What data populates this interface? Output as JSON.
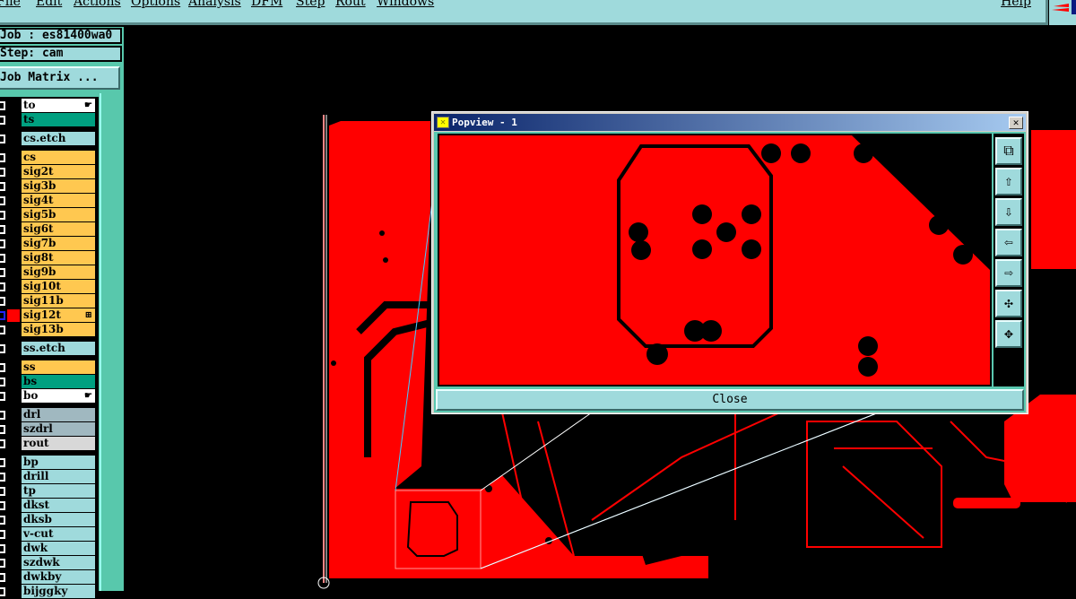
{
  "menu": [
    "File",
    "Edit",
    "Actions",
    "Options",
    "Analysis",
    "DFM",
    "Step",
    "Rout",
    "Windows"
  ],
  "menu_help": "Help",
  "job": "Job : es81400wa0",
  "step": "Step: cam",
  "job_matrix": "Job Matrix ...",
  "layers": [
    {
      "name": "to",
      "bg": "#ffffff",
      "hand": true
    },
    {
      "name": "ts",
      "bg": "#00a080"
    },
    {
      "name": "cs.etch",
      "bg": "#9fdadc"
    },
    {
      "name": "cs",
      "bg": "#ffc850"
    },
    {
      "name": "sig2t",
      "bg": "#ffc850"
    },
    {
      "name": "sig3b",
      "bg": "#ffc850"
    },
    {
      "name": "sig4t",
      "bg": "#ffc850"
    },
    {
      "name": "sig5b",
      "bg": "#ffc850"
    },
    {
      "name": "sig6t",
      "bg": "#ffc850"
    },
    {
      "name": "sig7b",
      "bg": "#ffc850"
    },
    {
      "name": "sig8t",
      "bg": "#ffc850"
    },
    {
      "name": "sig9b",
      "bg": "#ffc850"
    },
    {
      "name": "sig10t",
      "bg": "#ffc850"
    },
    {
      "name": "sig11b",
      "bg": "#ffc850"
    },
    {
      "name": "sig12t",
      "bg": "#ffc850",
      "active": true
    },
    {
      "name": "sig13b",
      "bg": "#ffc850"
    },
    {
      "name": "ss.etch",
      "bg": "#9fdadc"
    },
    {
      "name": "ss",
      "bg": "#ffc850"
    },
    {
      "name": "bs",
      "bg": "#00a080"
    },
    {
      "name": "bo",
      "bg": "#ffffff",
      "hand": true
    },
    {
      "name": "drl",
      "bg": "#a0b8c0"
    },
    {
      "name": "szdrl",
      "bg": "#a0b8c0"
    },
    {
      "name": "rout",
      "bg": "#d8d8d8"
    },
    {
      "name": "bp",
      "bg": "#9fdadc"
    },
    {
      "name": "drill",
      "bg": "#9fdadc"
    },
    {
      "name": "tp",
      "bg": "#9fdadc"
    },
    {
      "name": "dkst",
      "bg": "#9fdadc"
    },
    {
      "name": "dksb",
      "bg": "#9fdadc"
    },
    {
      "name": "v-cut",
      "bg": "#9fdadc"
    },
    {
      "name": "dwk",
      "bg": "#9fdadc"
    },
    {
      "name": "szdwk",
      "bg": "#9fdadc"
    },
    {
      "name": "dwkby",
      "bg": "#9fdadc"
    },
    {
      "name": "bijggky",
      "bg": "#9fdadc"
    }
  ],
  "popview": {
    "title": "Popview - 1",
    "close": "Close",
    "tools": [
      "zoom-home-icon",
      "pan-up-icon",
      "pan-down-icon",
      "pan-left-icon",
      "pan-right-icon",
      "zoom-in-icon",
      "zoom-out-icon"
    ]
  },
  "colors": {
    "board": "#ff0000",
    "active_layer": "#ff0000"
  }
}
